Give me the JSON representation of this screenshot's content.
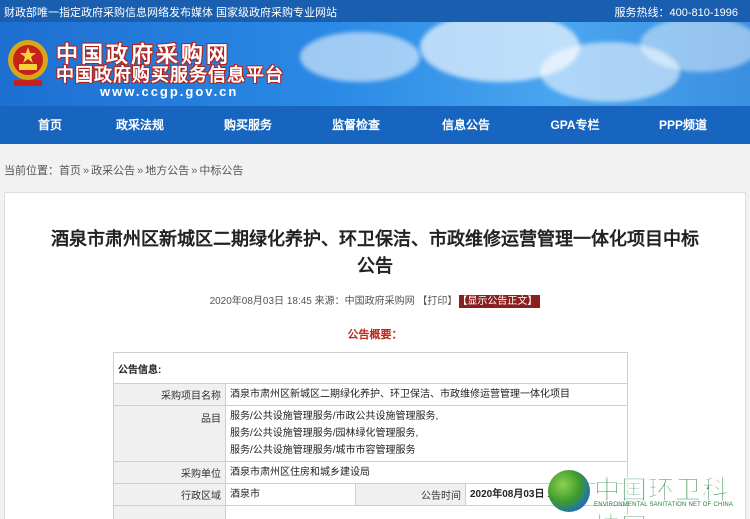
{
  "topbar": {
    "notice": "财政部唯一指定政府采购信息网络发布媒体 国家级政府采购专业网站",
    "hotline": "服务热线：400-810-1996"
  },
  "banner": {
    "title": "中国政府采购网",
    "subtitle": "中国政府购买服务信息平台",
    "url": "www.ccgp.gov.cn"
  },
  "nav": {
    "items": [
      {
        "label": "首页"
      },
      {
        "label": "政采法规"
      },
      {
        "label": "购买服务"
      },
      {
        "label": "监督检查"
      },
      {
        "label": "信息公告"
      },
      {
        "label": "GPA专栏"
      },
      {
        "label": "PPP频道"
      }
    ]
  },
  "breadcrumb": {
    "prefix": "当前位置：",
    "items": [
      "首页",
      "政采公告",
      "地方公告",
      "中标公告"
    ],
    "separator": "»"
  },
  "article": {
    "title_line1": "酒泉市肃州区新城区二期绿化养护、环卫保洁、市政维修运营管理一体化项目中标",
    "title_line2": "公告",
    "meta": "2020年08月03日 18:45 来源：中国政府采购网 【打印】",
    "show_text_button": "【显示公告正文】",
    "summary_label": "公告概要："
  },
  "table": {
    "header": "公告信息:",
    "rows": [
      {
        "label": "采购项目名称",
        "value": "酒泉市肃州区新城区二期绿化养护、环卫保洁、市政维修运营管理一体化项目"
      },
      {
        "label": "品目",
        "value_lines": [
          "服务/公共设施管理服务/市政公共设施管理服务,",
          "服务/公共设施管理服务/园林绿化管理服务,",
          "服务/公共设施管理服务/城市市容管理服务"
        ]
      },
      {
        "label": "采购单位",
        "value": "酒泉市肃州区住房和城乡建设局"
      },
      {
        "label": "行政区域",
        "value": "酒泉市",
        "label2": "公告时间",
        "value2": "2020年08月03日 18:45"
      }
    ]
  },
  "watermark": {
    "name": "中国环卫科技网",
    "english": "ENVIRONMENTAL SANITATION NET OF CHINA"
  },
  "colors": {
    "nav_blue": "#1765bf",
    "accent_red": "#c0271d",
    "show_button": "#8a1f1f"
  }
}
